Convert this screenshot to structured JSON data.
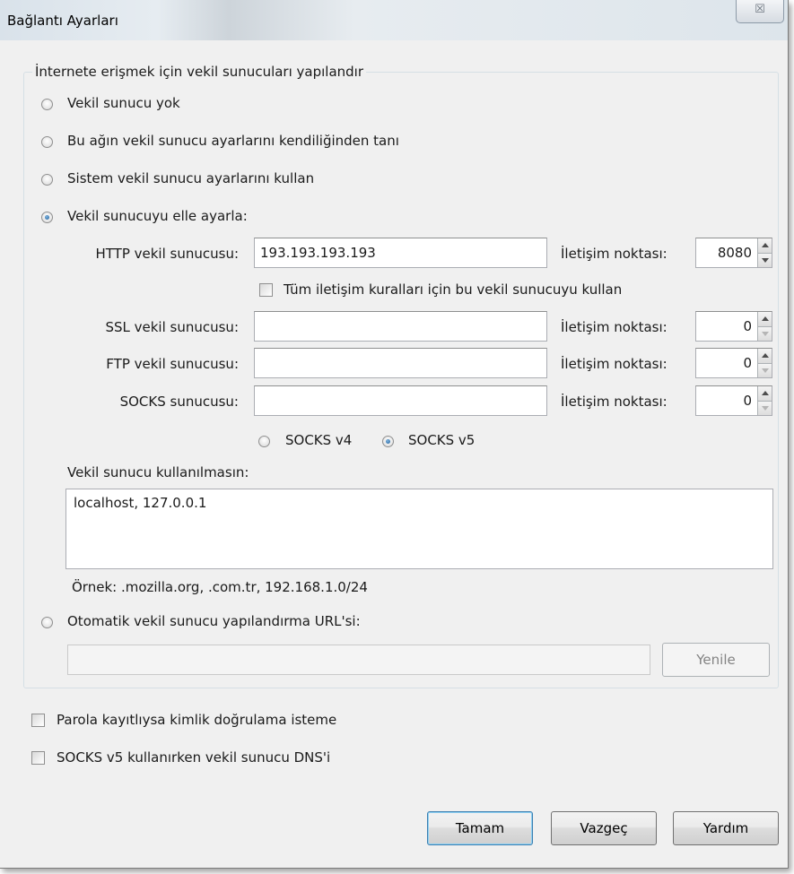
{
  "window": {
    "title": "Bağlantı Ayarları",
    "close_icon": "close-icon"
  },
  "group": {
    "legend": "İnternete erişmek için vekil sunucuları yapılandır",
    "radios": {
      "no_proxy": {
        "label": "Vekil sunucu yok",
        "checked": false
      },
      "auto_detect": {
        "label": "Bu ağın vekil sunucu ayarlarını kendiliğinden tanı",
        "checked": false
      },
      "system": {
        "label": "Sistem vekil sunucu ayarlarını kullan",
        "checked": false
      },
      "manual": {
        "label": "Vekil sunucuyu elle ayarla:",
        "checked": true
      },
      "auto_url": {
        "label": "Otomatik vekil sunucu yapılandırma URL'si:",
        "checked": false
      }
    },
    "http": {
      "label": "HTTP vekil sunucusu:",
      "value": "193.193.193.193",
      "port_label": "İletişim noktası:",
      "port": "8080"
    },
    "use_for_all": {
      "label": "Tüm iletişim kuralları için bu vekil sunucuyu kullan",
      "checked": false
    },
    "ssl": {
      "label": "SSL vekil sunucusu:",
      "value": "",
      "port_label": "İletişim noktası:",
      "port": "0"
    },
    "ftp": {
      "label": "FTP vekil sunucusu:",
      "value": "",
      "port_label": "İletişim noktası:",
      "port": "0"
    },
    "socks": {
      "label": "SOCKS sunucusu:",
      "value": "",
      "port_label": "İletişim noktası:",
      "port": "0"
    },
    "socks_version": {
      "v4": "SOCKS v4",
      "v5": "SOCKS v5",
      "selected": "v5"
    },
    "no_proxy_for": {
      "label": "Vekil sunucu kullanılmasın:",
      "value": "localhost, 127.0.0.1",
      "example": "Örnek: .mozilla.org, .com.tr, 192.168.1.0/24"
    },
    "auto_url": {
      "value": "",
      "reload_label": "Yenile"
    }
  },
  "checks": {
    "no_auth_prompt": {
      "label": "Parola kayıtlıysa kimlik doğrulama isteme",
      "checked": false
    },
    "remote_dns": {
      "label": "SOCKS v5 kullanırken vekil sunucu DNS'i",
      "checked": false
    }
  },
  "buttons": {
    "ok": "Tamam",
    "cancel": "Vazgeç",
    "help": "Yardım"
  }
}
